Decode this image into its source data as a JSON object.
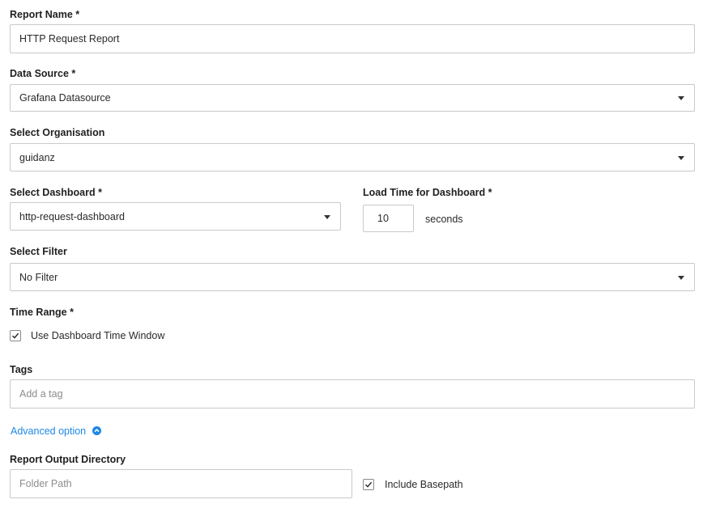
{
  "report_name": {
    "label": "Report Name *",
    "value": "HTTP Request Report"
  },
  "data_source": {
    "label": "Data Source *",
    "value": "Grafana Datasource"
  },
  "organisation": {
    "label": "Select Organisation",
    "value": "guidanz"
  },
  "dashboard": {
    "label": "Select Dashboard *",
    "value": "http-request-dashboard"
  },
  "load_time": {
    "label": "Load Time for Dashboard *",
    "value": "10",
    "unit": "seconds"
  },
  "filter": {
    "label": "Select Filter",
    "value": "No Filter"
  },
  "time_range": {
    "label": "Time Range *",
    "checkbox_label": "Use Dashboard Time Window",
    "checked": true
  },
  "tags": {
    "label": "Tags",
    "placeholder": "Add a tag"
  },
  "advanced": {
    "label": "Advanced option",
    "icon": "chevron-up-circle-icon"
  },
  "output_dir": {
    "label": "Report Output Directory",
    "placeholder": "Folder Path"
  },
  "basepath": {
    "checkbox_label": "Include Basepath",
    "checked": true
  },
  "colors": {
    "accent": "#1e88e5",
    "border": "#c9c9c9"
  }
}
